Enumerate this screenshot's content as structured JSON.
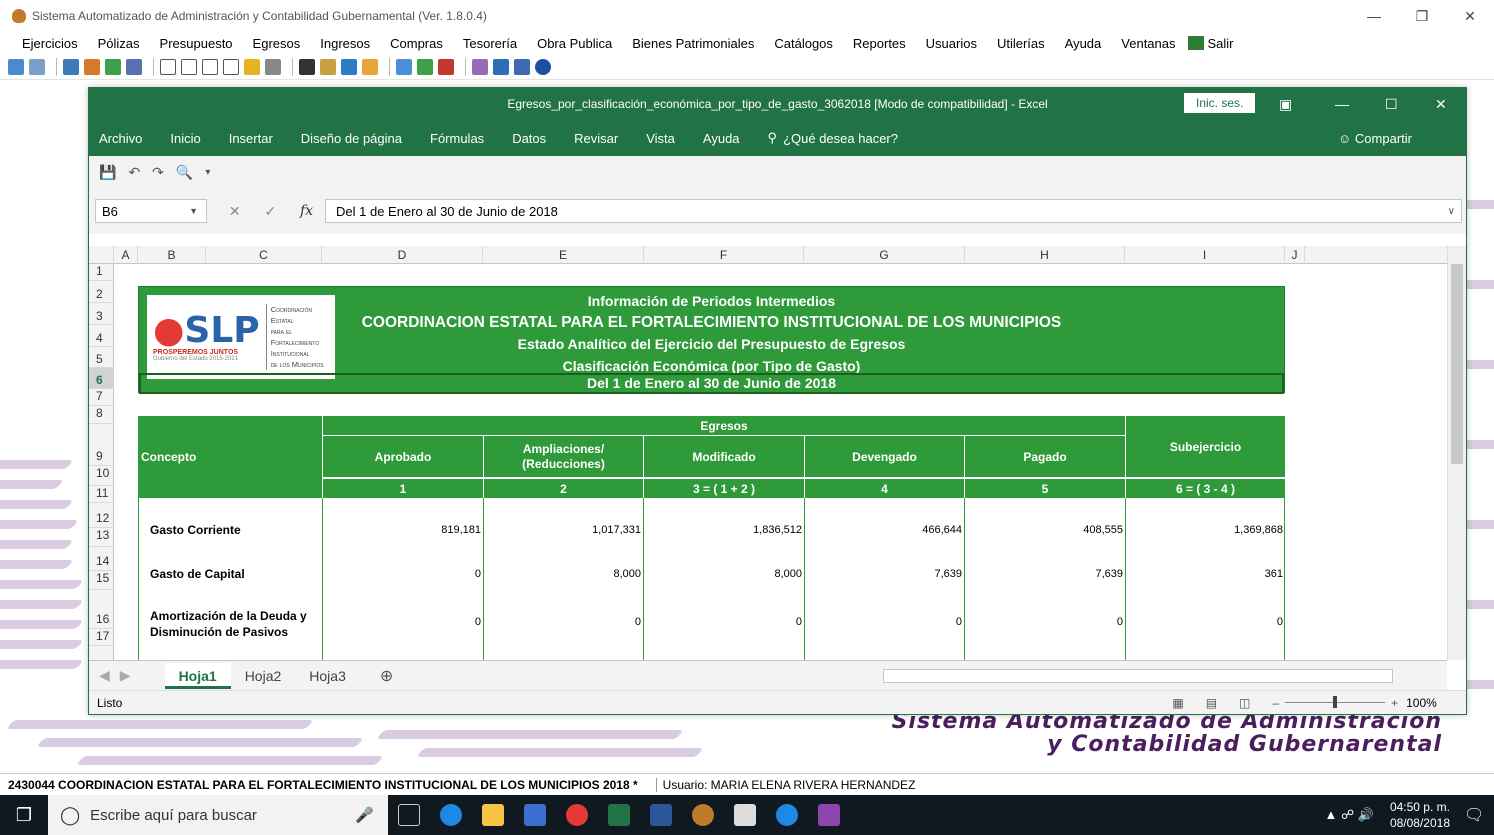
{
  "outer_window": {
    "title": "Sistema Automatizado de Administración y Contabilidad Gubernamental  (Ver. 1.8.0.4)",
    "menu": [
      "Ejercicios",
      "Pólizas",
      "Presupuesto",
      "Egresos",
      "Ingresos",
      "Compras",
      "Tesorería",
      "Obra Publica",
      "Bienes Patrimoniales",
      "Catálogos",
      "Reportes",
      "Usuarios",
      "Utilerías",
      "Ayuda",
      "Ventanas"
    ],
    "exit_label": "Salir",
    "background_title_line1": "Sistema Automatizado de Administración",
    "background_title_line2": "y Contabilidad Gubernarental"
  },
  "excel": {
    "title": "Egresos_por_clasificación_económica_por_tipo_de_gasto_3062018  [Modo de compatibilidad]  -  Excel",
    "login_button": "Inic. ses.",
    "ribbon_tabs": [
      "Archivo",
      "Inicio",
      "Insertar",
      "Diseño de página",
      "Fórmulas",
      "Datos",
      "Revisar",
      "Vista",
      "Ayuda"
    ],
    "tell_me": "¿Qué desea hacer?",
    "share": "Compartir",
    "name_box": "B6",
    "formula": "Del 1 de Enero al 30 de Junio de 2018",
    "columns": [
      "A",
      "B",
      "C",
      "D",
      "E",
      "F",
      "G",
      "H",
      "I",
      "J"
    ],
    "rows": [
      "1",
      "2",
      "3",
      "4",
      "5",
      "6",
      "7",
      "8",
      "9",
      "10",
      "11",
      "12",
      "13",
      "14",
      "15",
      "16",
      "17"
    ],
    "banner": {
      "line1": "Información de Periodos Intermedios",
      "line2": "COORDINACION ESTATAL PARA EL FORTALECIMIENTO INSTITUCIONAL DE LOS MUNICIPIOS",
      "line3": "Estado Analítico del Ejercicio del Presupuesto de Egresos",
      "line4": "Clasificación Económica (por Tipo de Gasto)",
      "line5": "Del 1 de Enero al 30 de Junio de 2018"
    },
    "logo": {
      "mark": "SLP",
      "tag": "PROSPEREMOS JUNTOS",
      "sub": "Gobierno del Estado 2015-2021",
      "org": [
        "Coordinación Estatal",
        "para el Fortalecimiento",
        "Institucional",
        "de los Municipios"
      ]
    },
    "table": {
      "concept_header": "Concepto",
      "group_header": "Egresos",
      "subejercicio": "Subejercicio",
      "col_headers": [
        "Aprobado",
        "Ampliaciones/ (Reducciones)",
        "Modificado",
        "Devengado",
        "Pagado"
      ],
      "col_numbers": [
        "1",
        "2",
        "3 = ( 1 + 2 )",
        "4",
        "5",
        "6 = ( 3 - 4 )"
      ],
      "rows": [
        {
          "concept": "Gasto Corriente",
          "values": [
            "819,181",
            "1,017,331",
            "1,836,512",
            "466,644",
            "408,555",
            "1,369,868"
          ]
        },
        {
          "concept": "Gasto de Capital",
          "values": [
            "0",
            "8,000",
            "8,000",
            "7,639",
            "7,639",
            "361"
          ]
        },
        {
          "concept": "Amortización de la Deuda y Disminución de Pasivos",
          "values": [
            "0",
            "0",
            "0",
            "0",
            "0",
            "0"
          ]
        }
      ]
    },
    "sheet_tabs": [
      "Hoja1",
      "Hoja2",
      "Hoja3"
    ],
    "active_sheet": "Hoja1",
    "status": "Listo",
    "zoom": "100%"
  },
  "footer": {
    "entity": "2430044 COORDINACION ESTATAL PARA EL FORTALECIMIENTO INSTITUCIONAL DE LOS MUNICIPIOS  2018   *",
    "user": "Usuario: MARIA ELENA RIVERA HERNANDEZ"
  },
  "taskbar": {
    "search_placeholder": "Escribe aquí para buscar",
    "time": "04:50 p. m.",
    "date": "08/08/2018"
  }
}
